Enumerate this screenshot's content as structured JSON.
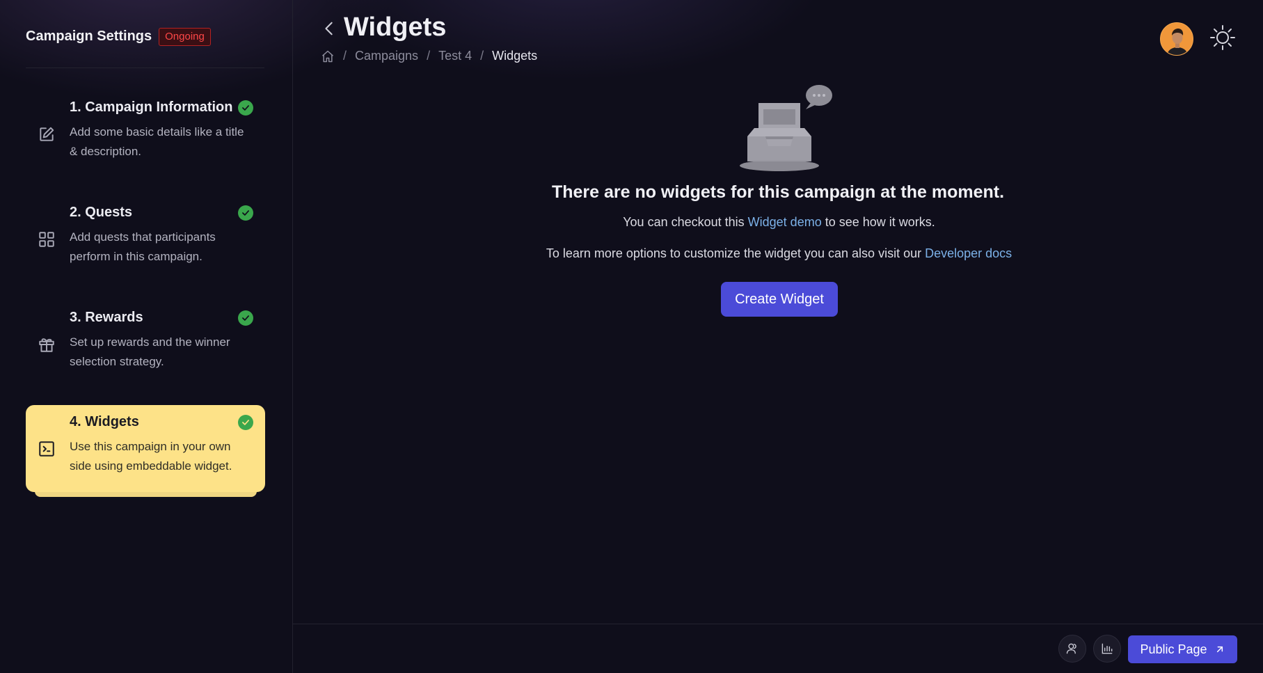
{
  "sidebar": {
    "title": "Campaign Settings",
    "status_badge": "Ongoing",
    "steps": [
      {
        "title": "1. Campaign Information",
        "description": "Add some basic details like a title & description.",
        "icon": "edit-icon",
        "completed": true,
        "active": false
      },
      {
        "title": "2. Quests",
        "description": "Add quests that participants perform in this campaign.",
        "icon": "grid-icon",
        "completed": true,
        "active": false
      },
      {
        "title": "3. Rewards",
        "description": "Set up rewards and the winner selection strategy.",
        "icon": "gift-icon",
        "completed": true,
        "active": false
      },
      {
        "title": "4. Widgets",
        "description": "Use this campaign in your own side using embeddable widget.",
        "icon": "terminal-icon",
        "completed": true,
        "active": true
      }
    ]
  },
  "header": {
    "title": "Widgets",
    "breadcrumb": [
      "Campaigns",
      "Test 4",
      "Widgets"
    ]
  },
  "empty_state": {
    "title": "There are no widgets for this campaign at the moment.",
    "line1_prefix": "You can checkout this ",
    "line1_link": "Widget demo",
    "line1_suffix": " to see how it works.",
    "line2_prefix": "To learn more options to customize the widget you can also visit our ",
    "line2_link": "Developer docs",
    "create_button": "Create Widget"
  },
  "footer": {
    "public_page_button": "Public Page"
  },
  "colors": {
    "background": "#0f0e1b",
    "accent": "#4b4bd8",
    "active_step": "#fde288",
    "check": "#3aa74c",
    "link": "#7cb1e8",
    "badge": "#ff4747"
  }
}
